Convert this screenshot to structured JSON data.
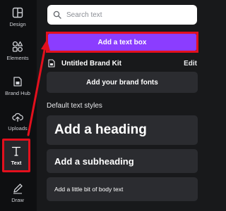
{
  "rail": {
    "items": [
      {
        "label": "Design",
        "icon": "design-icon"
      },
      {
        "label": "Elements",
        "icon": "elements-icon"
      },
      {
        "label": "Brand Hub",
        "icon": "brand-hub-icon"
      },
      {
        "label": "Uploads",
        "icon": "uploads-icon"
      },
      {
        "label": "Text",
        "icon": "text-icon",
        "active": true
      },
      {
        "label": "Draw",
        "icon": "draw-icon"
      }
    ]
  },
  "panel": {
    "search": {
      "placeholder": "Search text",
      "value": ""
    },
    "add_textbox_label": "Add a text box",
    "brand_kit": {
      "name": "Untitled Brand Kit",
      "edit_label": "Edit"
    },
    "brand_fonts_label": "Add your brand fonts",
    "section_title": "Default text styles",
    "styles": {
      "heading": "Add a heading",
      "subheading": "Add a subheading",
      "body": "Add a little bit of body text"
    }
  },
  "colors": {
    "accent": "#8b3dff",
    "highlight": "#e3101d",
    "background": "#18191b",
    "rail": "#0e0f11",
    "card": "#2b2c30"
  }
}
